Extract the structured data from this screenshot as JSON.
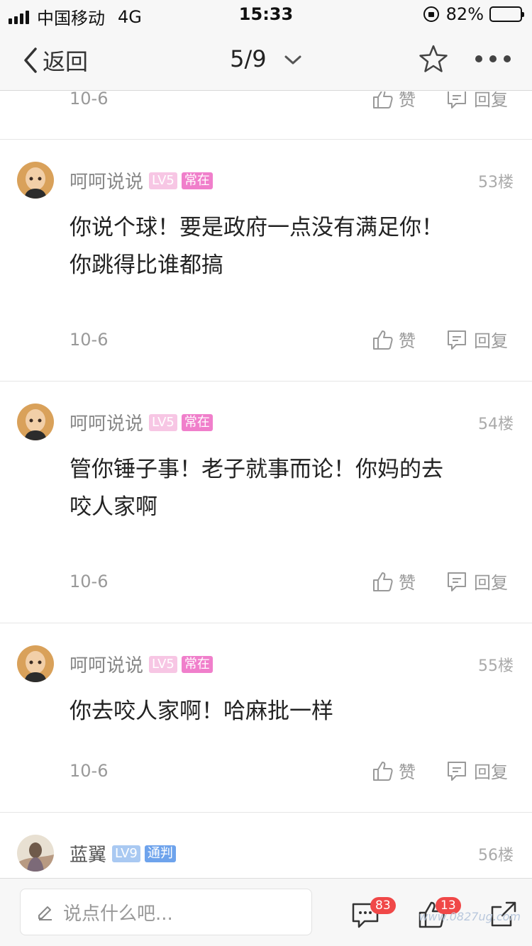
{
  "status_bar": {
    "carrier": "中国移动",
    "network": "4G",
    "time": "15:33",
    "battery_percent": "82%",
    "battery_level": 0.82
  },
  "nav": {
    "back_label": "返回",
    "page_indicator": "5/9"
  },
  "previous_post": {
    "date": "10-6",
    "like_label": "赞",
    "reply_label": "回复"
  },
  "posts": [
    {
      "username": "呵呵说说",
      "level": "LV5",
      "tag": "常在",
      "floor": "53楼",
      "content": [
        "你说个球！要是政府一点没有满足你！",
        "你跳得比谁都搞"
      ],
      "date": "10-6",
      "like_label": "赞",
      "reply_label": "回复"
    },
    {
      "username": "呵呵说说",
      "level": "LV5",
      "tag": "常在",
      "floor": "54楼",
      "content": [
        "管你锤子事！老子就事而论！你妈的去",
        "咬人家啊"
      ],
      "date": "10-6",
      "like_label": "赞",
      "reply_label": "回复"
    },
    {
      "username": "呵呵说说",
      "level": "LV5",
      "tag": "常在",
      "floor": "55楼",
      "content": [
        "你去咬人家啊！哈麻批一样"
      ],
      "date": "10-6",
      "like_label": "赞",
      "reply_label": "回复"
    },
    {
      "username": "蓝翼",
      "level": "LV9",
      "tag": "通判",
      "floor": "56楼"
    }
  ],
  "bottom_bar": {
    "input_placeholder": "说点什么吧...",
    "comment_count": "83",
    "like_count": "13"
  },
  "watermark": "www.0827ug.com",
  "colors": {
    "level_badge_pink": "#f7c6e4",
    "tag_badge_pink": "#f07fcb",
    "level_badge_blue": "#a9c9f2",
    "tag_badge_blue": "#6ea3ec",
    "count_badge_red": "#f04848"
  }
}
